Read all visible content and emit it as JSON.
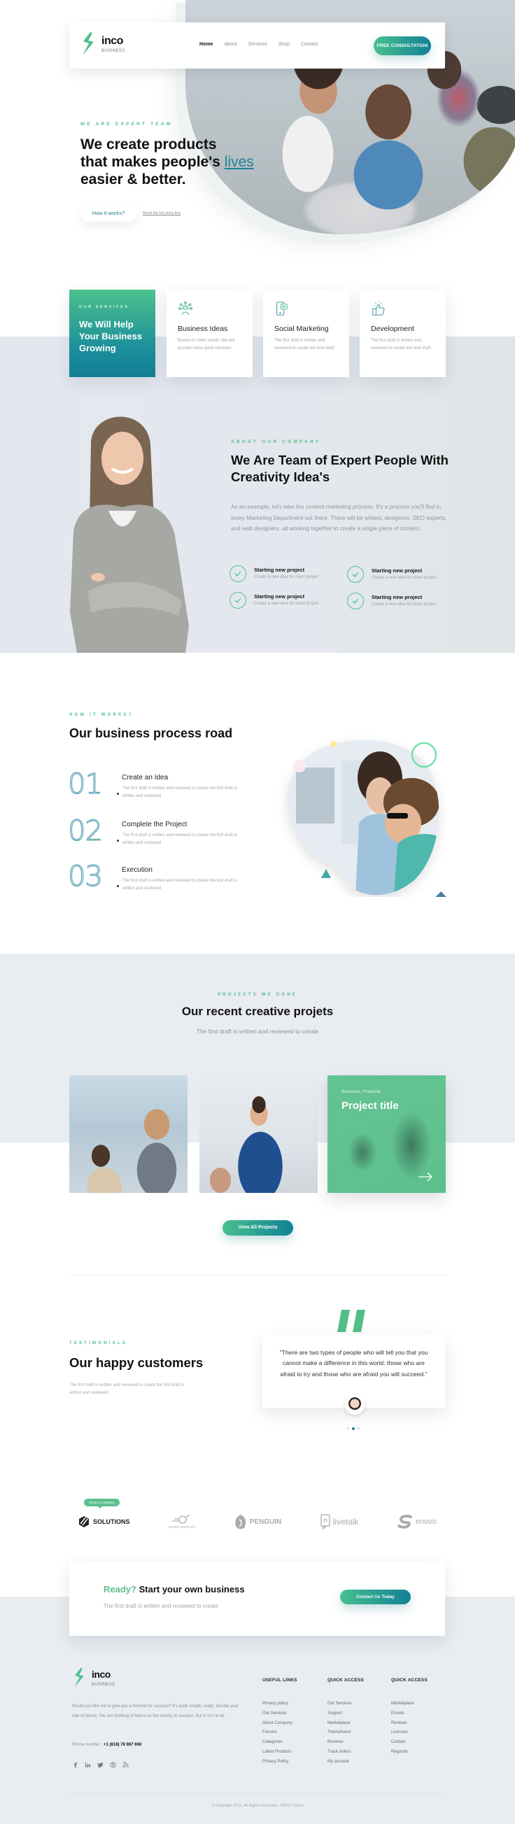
{
  "brand": {
    "name": "inco",
    "tagline": "BUSINESS",
    "accent_green": "#4fbf8c",
    "accent_teal": "#147f96"
  },
  "nav": {
    "links": [
      {
        "label": "Home",
        "active": true
      },
      {
        "label": "About",
        "active": false
      },
      {
        "label": "Services",
        "active": false
      },
      {
        "label": "Shop",
        "active": false
      },
      {
        "label": "Contact",
        "active": false
      }
    ],
    "cta_label": "FREE CONSULTATION"
  },
  "hero": {
    "eyebrow": "WE ARE EXPERT TEAM",
    "title_line1": "We create products",
    "title_line2_prefix": "that makes people's ",
    "title_highlight": "lives",
    "title_line3": "easier & better.",
    "primary_button": "How it works?",
    "secondary_link": "Read the full story line"
  },
  "services": {
    "eyebrow": "OUR SERVICES",
    "lead_title": "We Will Help Your Business Growing",
    "cards": [
      {
        "icon": "network-person-icon",
        "title": "Business Ideas",
        "desc": "Based on client needs, We will provide some good solutions."
      },
      {
        "icon": "phone-chat-icon",
        "title": "Social Marketing",
        "desc": "The first draft is written and reviewed to create the final draft."
      },
      {
        "icon": "thumbs-up-icon",
        "title": "Development",
        "desc": "The first draft is written and reviewed to create the final draft."
      }
    ]
  },
  "about": {
    "eyebrow": "ABOUT OUR COMPANY",
    "title": "We Are Team of Expert People With Creativity Idea's",
    "text": "As an example, let's take the content marketing process, It's a process you'll find in every Marketing Department out there. There will be writers, designers, SEO experts, and web designers, all working together to create a single piece of content.",
    "features": [
      {
        "title": "Starting new project",
        "desc": "Create a new idea for client project"
      },
      {
        "title": "Starting new project",
        "desc": "Create a new idea for client project"
      },
      {
        "title": "Starting new project",
        "desc": "Create a new idea for client project"
      },
      {
        "title": "Starting new project",
        "desc": "Create a new idea for client project"
      }
    ]
  },
  "process": {
    "eyebrow": "HOW IT WORKS?",
    "title": "Our business process road",
    "steps": [
      {
        "num": "01",
        "title": "Create an Idea",
        "desc": "The first draft is written and reviewed to create the first draft is written and reviewed"
      },
      {
        "num": "02",
        "title": "Complete the Project",
        "desc": "The first draft is written and reviewed to create the first draft is written and reviewed"
      },
      {
        "num": "03",
        "title": "Execution",
        "desc": "The first draft is written and reviewed to create the first draft is written and reviewed"
      }
    ]
  },
  "projects": {
    "eyebrow": "PROJECTS WE DONE",
    "title": "Our recent creative projets",
    "subtitle": "The first draft is written and reviewed to create",
    "featured": {
      "category": "Business, Financial",
      "title": "Project title"
    },
    "view_all_label": "View All Projects"
  },
  "testimonials": {
    "eyebrow": "TESTIMONIALS",
    "title": "Our happy customers",
    "desc": "The first draft is written and reviewed to create the first draft is written and reviewed",
    "quote": "\"There are two types of people who will tell you that you cannot make a difference in this world: those who are afraid to try and those who are afraid you will succeed.\"",
    "dots": 3,
    "active_dot": 1
  },
  "clients": {
    "badge": "Solution Company",
    "logos": [
      "SOLUTIONS",
      "SPEEDYSERVICE",
      "PENGUIN",
      "livetalk",
      "enovo"
    ]
  },
  "cta": {
    "ready": "Ready?",
    "title": "Start your own business",
    "subtitle": "The first draft is written and reviewed to create",
    "button": "Contact Us Today"
  },
  "footer": {
    "about": "Would you like me to give you a formula for success? It's quite simple, really: Double your rate of failure. You are thinking of failure as the enemy of success. But it isn't at all.",
    "phone_label": "Phone number:",
    "phone": "+1 (818) 78 987 666",
    "social": [
      "facebook-icon",
      "linkedin-icon",
      "twitter-icon",
      "skype-icon",
      "rss-icon"
    ],
    "columns": [
      {
        "title": "USEFUL LINKS",
        "links": [
          "Privacy policy",
          "Our Services",
          "About Company",
          "Forums",
          "Categories",
          "Latest Products",
          "Privacy Policy"
        ]
      },
      {
        "title": "QUICK ACCESS",
        "links": [
          "Our Services",
          "Support",
          "Marketplace",
          "Themeforest",
          "Reviews",
          "Track orders",
          "My account"
        ]
      },
      {
        "title": "QUICK ACCESS",
        "links": [
          "Marketplace",
          "Envato",
          "Reviews",
          "Licenses",
          "Contact",
          "Regunds"
        ]
      }
    ],
    "copyright": "© Copyright 2019. All Rights Reserved · INCO Theme"
  }
}
